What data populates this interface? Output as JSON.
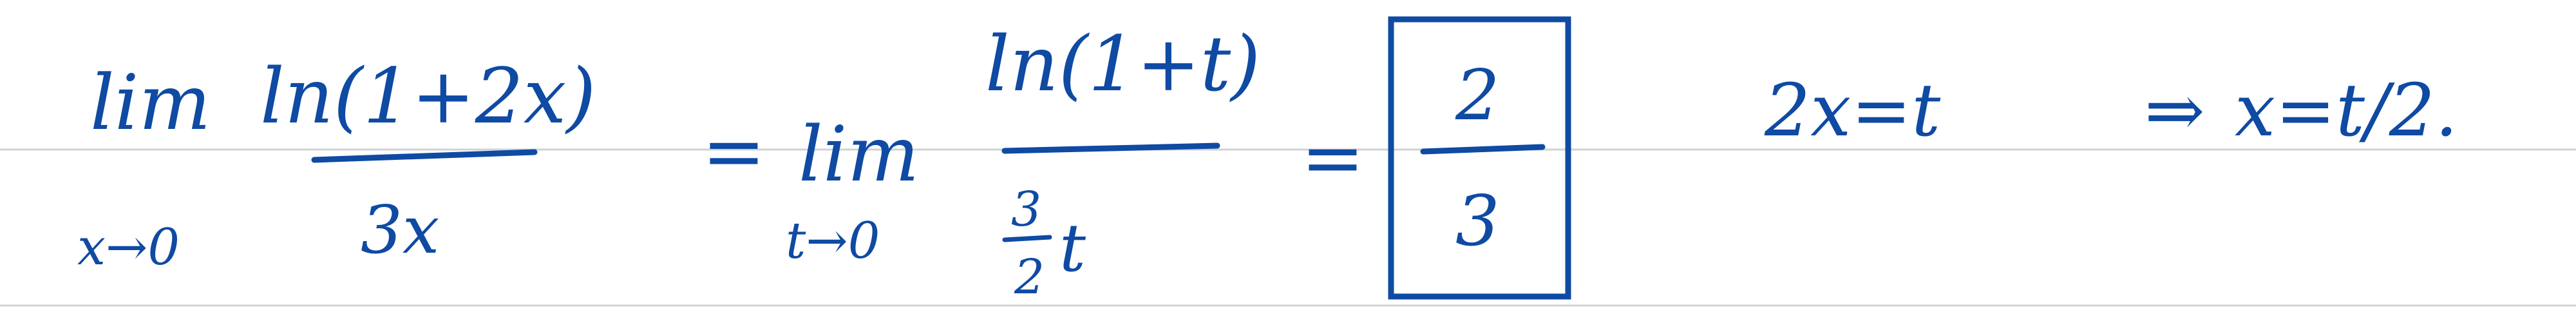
{
  "note": {
    "lhs": {
      "lim": "lim",
      "lim_sub": "x→0",
      "numerator": "ln(1+2x)",
      "denominator": "3x"
    },
    "eq1": "=",
    "rhs": {
      "lim": "lim",
      "lim_sub": "t→0",
      "numerator": "ln(1+t)",
      "den_frac_num": "3",
      "den_frac_den": "2",
      "den_var": "t"
    },
    "eq2": "=",
    "boxed_answer": {
      "numerator": "2",
      "denominator": "3"
    },
    "substitution": {
      "part1": "2x=t",
      "arrow": "⇒",
      "part2": "x=t/2."
    }
  },
  "colors": {
    "ink": "#0f4aa3",
    "rule": "#cfd2d6",
    "paper": "#ffffff"
  }
}
